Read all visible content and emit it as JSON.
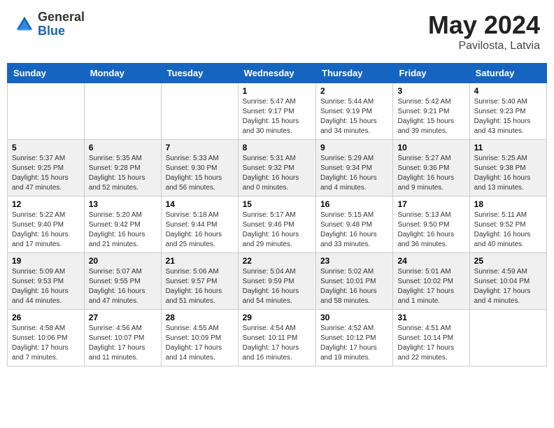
{
  "header": {
    "logo_general": "General",
    "logo_blue": "Blue",
    "month_year": "May 2024",
    "location": "Pavilosta, Latvia"
  },
  "weekdays": [
    "Sunday",
    "Monday",
    "Tuesday",
    "Wednesday",
    "Thursday",
    "Friday",
    "Saturday"
  ],
  "weeks": [
    [
      {
        "day": "",
        "info": ""
      },
      {
        "day": "",
        "info": ""
      },
      {
        "day": "",
        "info": ""
      },
      {
        "day": "1",
        "info": "Sunrise: 5:47 AM\nSunset: 9:17 PM\nDaylight: 15 hours\nand 30 minutes."
      },
      {
        "day": "2",
        "info": "Sunrise: 5:44 AM\nSunset: 9:19 PM\nDaylight: 15 hours\nand 34 minutes."
      },
      {
        "day": "3",
        "info": "Sunrise: 5:42 AM\nSunset: 9:21 PM\nDaylight: 15 hours\nand 39 minutes."
      },
      {
        "day": "4",
        "info": "Sunrise: 5:40 AM\nSunset: 9:23 PM\nDaylight: 15 hours\nand 43 minutes."
      }
    ],
    [
      {
        "day": "5",
        "info": "Sunrise: 5:37 AM\nSunset: 9:25 PM\nDaylight: 15 hours\nand 47 minutes."
      },
      {
        "day": "6",
        "info": "Sunrise: 5:35 AM\nSunset: 9:28 PM\nDaylight: 15 hours\nand 52 minutes."
      },
      {
        "day": "7",
        "info": "Sunrise: 5:33 AM\nSunset: 9:30 PM\nDaylight: 15 hours\nand 56 minutes."
      },
      {
        "day": "8",
        "info": "Sunrise: 5:31 AM\nSunset: 9:32 PM\nDaylight: 16 hours\nand 0 minutes."
      },
      {
        "day": "9",
        "info": "Sunrise: 5:29 AM\nSunset: 9:34 PM\nDaylight: 16 hours\nand 4 minutes."
      },
      {
        "day": "10",
        "info": "Sunrise: 5:27 AM\nSunset: 9:36 PM\nDaylight: 16 hours\nand 9 minutes."
      },
      {
        "day": "11",
        "info": "Sunrise: 5:25 AM\nSunset: 9:38 PM\nDaylight: 16 hours\nand 13 minutes."
      }
    ],
    [
      {
        "day": "12",
        "info": "Sunrise: 5:22 AM\nSunset: 9:40 PM\nDaylight: 16 hours\nand 17 minutes."
      },
      {
        "day": "13",
        "info": "Sunrise: 5:20 AM\nSunset: 9:42 PM\nDaylight: 16 hours\nand 21 minutes."
      },
      {
        "day": "14",
        "info": "Sunrise: 5:18 AM\nSunset: 9:44 PM\nDaylight: 16 hours\nand 25 minutes."
      },
      {
        "day": "15",
        "info": "Sunrise: 5:17 AM\nSunset: 9:46 PM\nDaylight: 16 hours\nand 29 minutes."
      },
      {
        "day": "16",
        "info": "Sunrise: 5:15 AM\nSunset: 9:48 PM\nDaylight: 16 hours\nand 33 minutes."
      },
      {
        "day": "17",
        "info": "Sunrise: 5:13 AM\nSunset: 9:50 PM\nDaylight: 16 hours\nand 36 minutes."
      },
      {
        "day": "18",
        "info": "Sunrise: 5:11 AM\nSunset: 9:52 PM\nDaylight: 16 hours\nand 40 minutes."
      }
    ],
    [
      {
        "day": "19",
        "info": "Sunrise: 5:09 AM\nSunset: 9:53 PM\nDaylight: 16 hours\nand 44 minutes."
      },
      {
        "day": "20",
        "info": "Sunrise: 5:07 AM\nSunset: 9:55 PM\nDaylight: 16 hours\nand 47 minutes."
      },
      {
        "day": "21",
        "info": "Sunrise: 5:06 AM\nSunset: 9:57 PM\nDaylight: 16 hours\nand 51 minutes."
      },
      {
        "day": "22",
        "info": "Sunrise: 5:04 AM\nSunset: 9:59 PM\nDaylight: 16 hours\nand 54 minutes."
      },
      {
        "day": "23",
        "info": "Sunrise: 5:02 AM\nSunset: 10:01 PM\nDaylight: 16 hours\nand 58 minutes."
      },
      {
        "day": "24",
        "info": "Sunrise: 5:01 AM\nSunset: 10:02 PM\nDaylight: 17 hours\nand 1 minute."
      },
      {
        "day": "25",
        "info": "Sunrise: 4:59 AM\nSunset: 10:04 PM\nDaylight: 17 hours\nand 4 minutes."
      }
    ],
    [
      {
        "day": "26",
        "info": "Sunrise: 4:58 AM\nSunset: 10:06 PM\nDaylight: 17 hours\nand 7 minutes."
      },
      {
        "day": "27",
        "info": "Sunrise: 4:56 AM\nSunset: 10:07 PM\nDaylight: 17 hours\nand 11 minutes."
      },
      {
        "day": "28",
        "info": "Sunrise: 4:55 AM\nSunset: 10:09 PM\nDaylight: 17 hours\nand 14 minutes."
      },
      {
        "day": "29",
        "info": "Sunrise: 4:54 AM\nSunset: 10:11 PM\nDaylight: 17 hours\nand 16 minutes."
      },
      {
        "day": "30",
        "info": "Sunrise: 4:52 AM\nSunset: 10:12 PM\nDaylight: 17 hours\nand 19 minutes."
      },
      {
        "day": "31",
        "info": "Sunrise: 4:51 AM\nSunset: 10:14 PM\nDaylight: 17 hours\nand 22 minutes."
      },
      {
        "day": "",
        "info": ""
      }
    ]
  ]
}
